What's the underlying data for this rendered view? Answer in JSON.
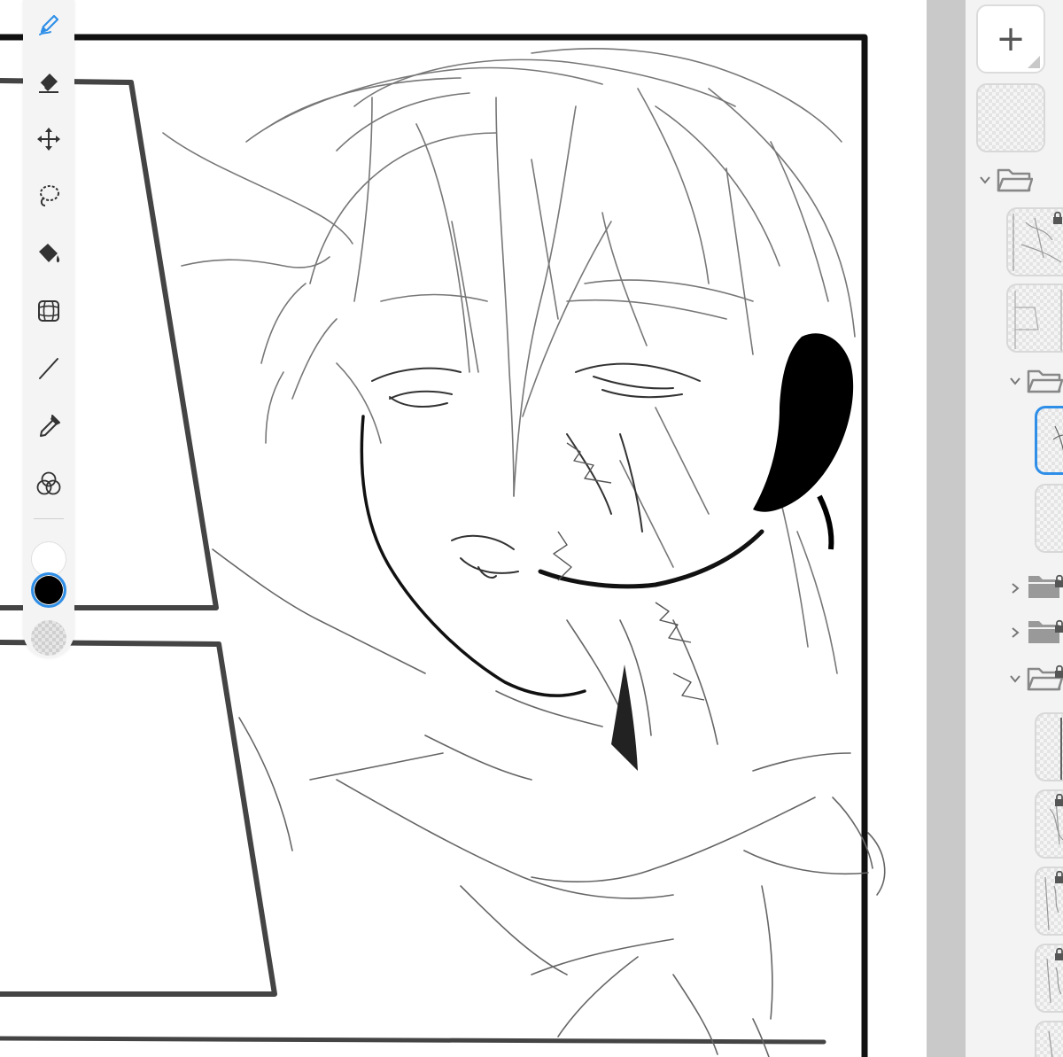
{
  "app": {
    "accent_color": "#2f8fe8",
    "canvas_background": "#ffffff",
    "panel_background": "#f3f3f3",
    "gutter_color": "#c9c9c9"
  },
  "toolbar": {
    "tools": [
      {
        "name": "pen",
        "icon": "pen-icon",
        "active": true
      },
      {
        "name": "eraser",
        "icon": "eraser-icon",
        "active": false
      },
      {
        "name": "move",
        "icon": "move-icon",
        "active": false
      },
      {
        "name": "lasso",
        "icon": "lasso-icon",
        "active": false
      },
      {
        "name": "fill",
        "icon": "fill-bucket-icon",
        "active": false
      },
      {
        "name": "transform",
        "icon": "transform-grid-icon",
        "active": false
      },
      {
        "name": "line",
        "icon": "line-icon",
        "active": false
      },
      {
        "name": "eyedropper",
        "icon": "eyedropper-icon",
        "active": false
      },
      {
        "name": "blend",
        "icon": "blend-circles-icon",
        "active": false
      }
    ],
    "colors": {
      "secondary": "#ffffff",
      "primary": "#000000",
      "transparent": "transparent"
    }
  },
  "layers_panel": {
    "add_label": "+",
    "items": [
      {
        "kind": "layer",
        "level": 0,
        "thumbnail": "empty-checker",
        "selected": false,
        "locked": false
      },
      {
        "kind": "folder",
        "level": 0,
        "expanded": true,
        "locked": false
      },
      {
        "kind": "layer",
        "level": 1,
        "thumbnail": "sketch-texture",
        "selected": false,
        "locked": true
      },
      {
        "kind": "layer",
        "level": 1,
        "thumbnail": "panel-frames",
        "selected": false,
        "locked": false
      },
      {
        "kind": "folder",
        "level": 1,
        "expanded": true,
        "locked": false
      },
      {
        "kind": "layer",
        "level": 2,
        "thumbnail": "figure-sketch",
        "selected": true,
        "locked": false
      },
      {
        "kind": "layer",
        "level": 2,
        "thumbnail": "empty-checker",
        "selected": false,
        "locked": false
      },
      {
        "kind": "folder",
        "level": 1,
        "expanded": false,
        "locked": true
      },
      {
        "kind": "folder",
        "level": 1,
        "expanded": false,
        "locked": true
      },
      {
        "kind": "folder",
        "level": 1,
        "expanded": true,
        "locked": true
      },
      {
        "kind": "layer",
        "level": 2,
        "thumbnail": "line-texture",
        "selected": false,
        "locked": false
      },
      {
        "kind": "layer",
        "level": 2,
        "thumbnail": "sketch-texture",
        "selected": false,
        "locked": true
      },
      {
        "kind": "layer",
        "level": 2,
        "thumbnail": "sketch-texture",
        "selected": false,
        "locked": true
      },
      {
        "kind": "layer",
        "level": 2,
        "thumbnail": "sketch-texture",
        "selected": false,
        "locked": true
      },
      {
        "kind": "layer",
        "level": 2,
        "thumbnail": "sketch-texture",
        "selected": false,
        "locked": false
      }
    ]
  }
}
